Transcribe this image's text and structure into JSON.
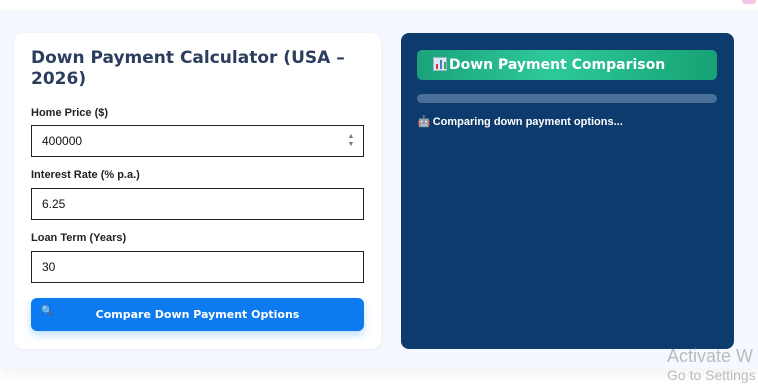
{
  "calculator": {
    "title": "Down Payment Calculator (USA – 2026)",
    "fields": [
      {
        "label": "Home Price ($)",
        "value": "400000"
      },
      {
        "label": "Interest Rate (% p.a.)",
        "value": "6.25"
      },
      {
        "label": "Loan Term (Years)",
        "value": "30"
      }
    ],
    "button_label": "Compare Down Payment Options",
    "button_icon": "magnifier-icon"
  },
  "results": {
    "header": "Down Payment Comparison",
    "header_icon": "bar-chart-icon",
    "progress_fraction": 0.0,
    "status_text": "Comparing down payment options...",
    "status_icon": "robot-icon"
  },
  "watermark": {
    "line1": "Activate W",
    "line2": "Go to Settings"
  },
  "colors": {
    "page_bg": "#f5f8ff",
    "button": "#0d7af0",
    "results_bg": "#0d3b6e",
    "header_green": "#1aa37a"
  }
}
